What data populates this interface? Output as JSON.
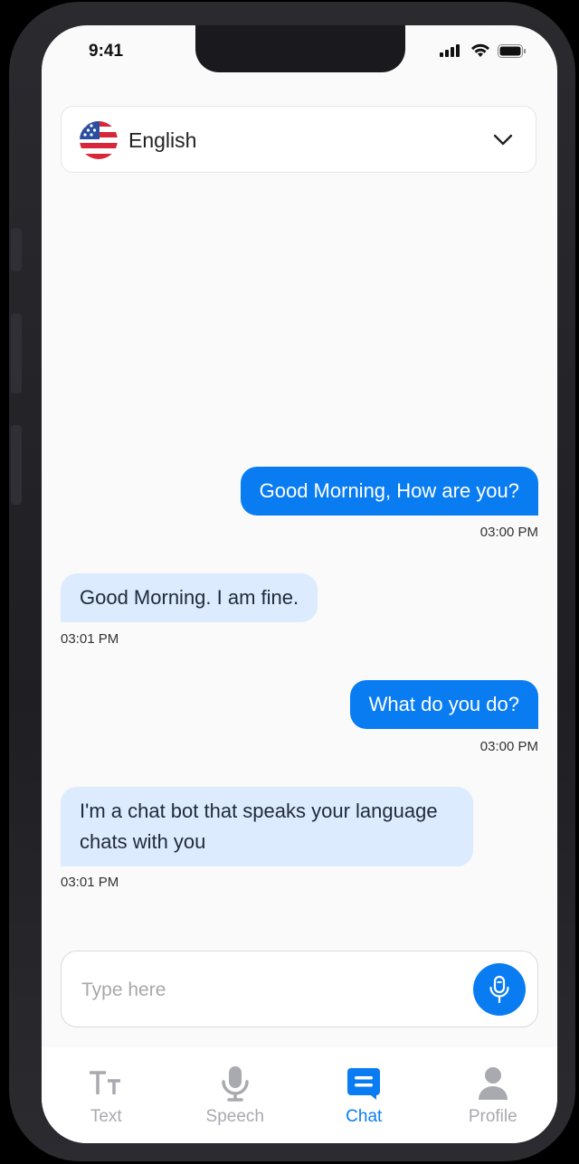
{
  "status_bar": {
    "time": "9:41"
  },
  "language_selector": {
    "selected": "English",
    "flag": "us-flag-icon"
  },
  "messages": [
    {
      "side": "sent",
      "text": "Good Morning, How are you?",
      "time": "03:00 PM"
    },
    {
      "side": "received",
      "text": "Good Morning. I am fine.",
      "time": "03:01 PM"
    },
    {
      "side": "sent",
      "text": "What do you do?",
      "time": "03:00 PM"
    },
    {
      "side": "received",
      "text": "I'm a chat bot that speaks your language chats with you",
      "time": "03:01 PM"
    }
  ],
  "composer": {
    "placeholder": "Type here",
    "value": ""
  },
  "tab_bar": {
    "items": [
      {
        "label": "Text",
        "icon": "text-size-icon",
        "active": false
      },
      {
        "label": "Speech",
        "icon": "microphone-icon",
        "active": false
      },
      {
        "label": "Chat",
        "icon": "chat-icon",
        "active": true
      },
      {
        "label": "Profile",
        "icon": "person-icon",
        "active": false
      }
    ]
  },
  "colors": {
    "accent": "#0a7cf2",
    "received_bubble": "#dcebfd",
    "inactive_tab": "#a9a9b0"
  }
}
